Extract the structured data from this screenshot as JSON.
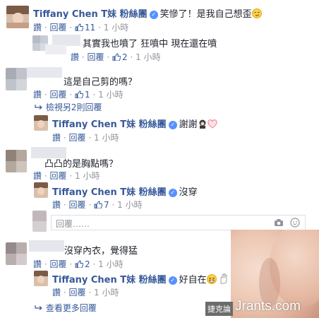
{
  "labels": {
    "like": "讚",
    "reply": "回覆",
    "dot": "·"
  },
  "comments": [
    {
      "id": "c1",
      "author": "Tiffany Chen T妹 粉絲團",
      "text": "笑慘了！是我自己想歪",
      "likes": "11",
      "time": "1 小時"
    },
    {
      "id": "c1r1",
      "text": "其實我也噴了 狂噴中 現在還在噴",
      "likes": "2",
      "time": "1 小時"
    },
    {
      "id": "c2",
      "text": "這是自己剪的嗎？",
      "likes": "1",
      "time": "1 小時"
    },
    {
      "id": "c2r1",
      "author": "Tiffany Chen T妹 粉絲團",
      "text": "謝謝",
      "time": "1 小時"
    },
    {
      "id": "c3",
      "text": "凸凸的是胸點嗎？",
      "time": "1 小時"
    },
    {
      "id": "c3r1",
      "author": "Tiffany Chen T妹 粉絲團",
      "text": "沒穿",
      "likes": "7",
      "time": "1 小時"
    },
    {
      "id": "c4",
      "text": "沒穿內衣，覺得猛",
      "likes": "2",
      "time": "1 小時"
    },
    {
      "id": "c4r1",
      "author": "Tiffany Chen T妹 粉絲團",
      "text": "好自在",
      "time": "1 小時"
    }
  ],
  "view_more_replies_2": "檢視另2則回覆",
  "view_more_replies": "查看更多回覆",
  "reply_placeholder": "回覆……",
  "watermark": "Jrants.com",
  "watermark_badge": "捷克論",
  "colors": {
    "link": "#365899",
    "meta": "#90949c",
    "verified": "#5890ff"
  }
}
